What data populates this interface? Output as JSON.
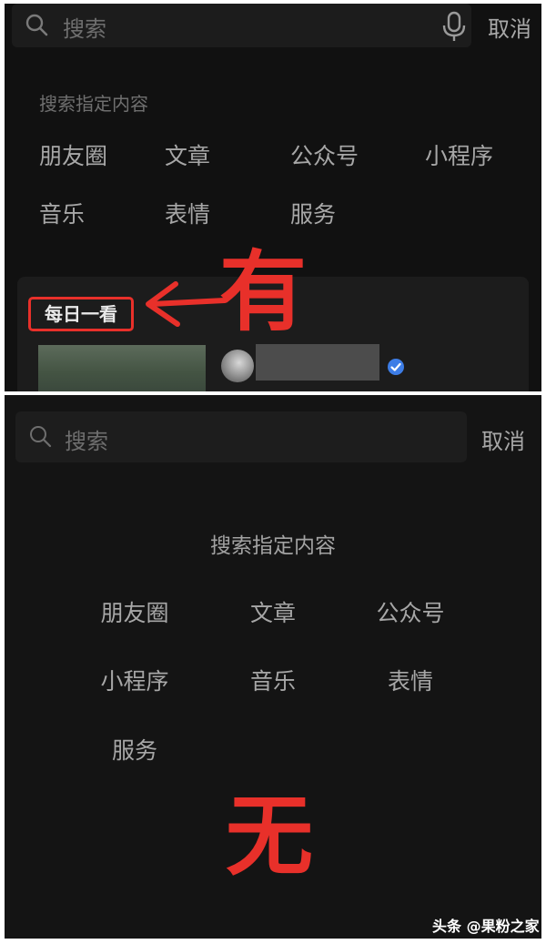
{
  "top": {
    "search_placeholder": "搜索",
    "cancel": "取消",
    "section_title": "搜索指定内容",
    "items": [
      "朋友圈",
      "文章",
      "公众号",
      "小程序",
      "音乐",
      "表情",
      "服务"
    ],
    "tag": "每日一看",
    "annotation": "有"
  },
  "bottom": {
    "search_placeholder": "搜索",
    "cancel": "取消",
    "section_title": "搜索指定内容",
    "items": [
      "朋友圈",
      "文章",
      "公众号",
      "小程序",
      "音乐",
      "表情",
      "服务"
    ],
    "annotation": "无"
  },
  "watermark": "头条 @果粉之家",
  "colors": {
    "annotation_red": "#e8302a",
    "background": "#111111",
    "verified_blue": "#3d7de6"
  },
  "icons": [
    "search-icon",
    "microphone-icon",
    "verified-icon",
    "arrow-left-icon"
  ]
}
